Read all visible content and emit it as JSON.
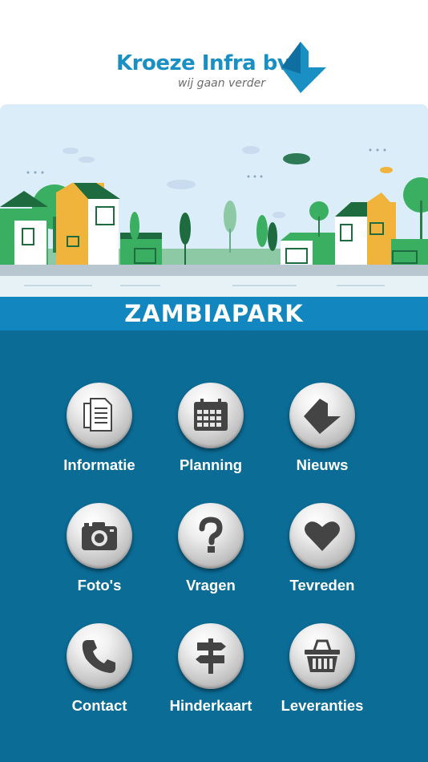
{
  "header": {
    "brand_name": "Kroeze Infra bv",
    "tagline": "wij gaan verder",
    "brand_color": "#1a8fc4"
  },
  "banner": {
    "illustration": "suburban-houses-street-illustration",
    "title": "ZAMBIAPARK",
    "title_bar_color": "#1287bf"
  },
  "menu": {
    "background_color": "#0b6c96",
    "items": [
      {
        "label": "Informatie",
        "icon": "document-icon"
      },
      {
        "label": "Planning",
        "icon": "calendar-icon"
      },
      {
        "label": "Nieuws",
        "icon": "kroeze-logo-icon"
      },
      {
        "label": "Foto's",
        "icon": "camera-icon"
      },
      {
        "label": "Vragen",
        "icon": "question-mark-icon"
      },
      {
        "label": "Tevreden",
        "icon": "heart-icon"
      },
      {
        "label": "Contact",
        "icon": "phone-icon"
      },
      {
        "label": "Hinderkaart",
        "icon": "signpost-icon"
      },
      {
        "label": "Leveranties",
        "icon": "basket-icon"
      }
    ]
  }
}
